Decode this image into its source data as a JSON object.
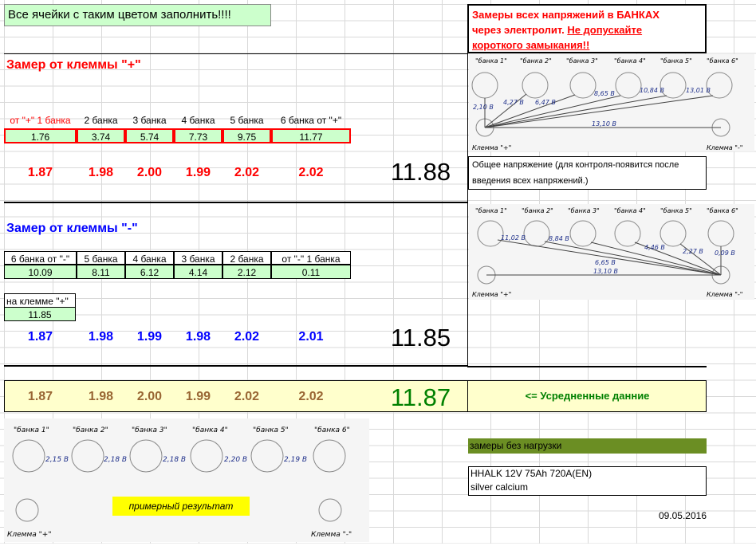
{
  "notice": "Все ячейки с таким цветом заполнить!!!!",
  "warning": {
    "line1": "Замеры всех напряжений в БАНКАХ",
    "line2a": "через электролит. ",
    "line2b": "Не допускайте",
    "line3": "короткого замыкания!!"
  },
  "plus_section": {
    "title": "Замер от клеммы \"+\"",
    "headers": [
      "от \"+\" 1 банка",
      "2 банка",
      "3 банка",
      "4 банка",
      "5 банка",
      "6 банка от \"+\""
    ],
    "values": [
      "1.76",
      "3.74",
      "5.74",
      "7.73",
      "9.75",
      "11.77"
    ],
    "cells": [
      "1.87",
      "1.98",
      "2.00",
      "1.99",
      "2.02",
      "2.02"
    ],
    "total": "11.88",
    "note": "Общее напряжение (для контроля-появится после введения всех напряжений.)"
  },
  "minus_section": {
    "title": "Замер от клеммы \"-\"",
    "headers": [
      "6 банка от \"-\"",
      "5 банка",
      "4 банка",
      "3 банка",
      "2 банка",
      "от \"-\" 1 банка"
    ],
    "values": [
      "10.09",
      "8.11",
      "6.12",
      "4.14",
      "2.12",
      "0.11"
    ],
    "plus_label": "на клемме \"+\"",
    "plus_value": "11.85",
    "cells": [
      "1.87",
      "1.98",
      "1.99",
      "1.98",
      "2.02",
      "2.01"
    ],
    "total": "11.85"
  },
  "average": {
    "cells": [
      "1.87",
      "1.98",
      "2.00",
      "1.99",
      "2.02",
      "2.02"
    ],
    "total": "11.87",
    "label": "<= Усредненные данние"
  },
  "diagram_top": {
    "banks": [
      "\"банка 1\"",
      "\"банка 2\"",
      "\"банка 3\"",
      "\"банка 4\"",
      "\"банка 5\"",
      "\"банка 6\""
    ],
    "readings": [
      "2,10 В",
      "4,27 В",
      "6,47 В",
      "8,65 В",
      "10,84 В",
      "13,01 В",
      "13,10 В"
    ],
    "terminal_plus": "Клемма \"+\"",
    "terminal_minus": "Клемма \"-\""
  },
  "diagram_mid": {
    "banks": [
      "\"банка 1\"",
      "\"банка 2\"",
      "\"банка 3\"",
      "\"банка 4\"",
      "\"банка 5\"",
      "\"банка 6\""
    ],
    "readings": [
      "11,02 В",
      "8,84 В",
      "6,65 В",
      "4,46 В",
      "2,27 В",
      "0,09 В",
      "13,10 В"
    ],
    "terminal_plus": "Клемма \"+\"",
    "terminal_minus": "Клемма \"-\""
  },
  "diagram_bottom": {
    "banks": [
      "\"банка 1\"",
      "\"банка 2\"",
      "\"банка 3\"",
      "\"банка 4\"",
      "\"банка 5\"",
      "\"банка 6\""
    ],
    "readings": [
      "2,15 В",
      "2,18 В",
      "2,18 В",
      "2,20 В",
      "2,19 В"
    ],
    "example": "примерный результат",
    "terminal_plus": "Клемма \"+\"",
    "terminal_minus": "Клемма \"-\""
  },
  "no_load": "замеры без нагрузки",
  "battery": {
    "line1": "HHALK 12V 75Ah 720A(EN)",
    "line2": "silver calcium"
  },
  "date": "09.05.2016",
  "colors": {
    "input_fill": "#ccffcc",
    "average_fill": "#ffffcc",
    "no_load_fill": "#6b8e23",
    "example_fill": "#ffff00"
  }
}
